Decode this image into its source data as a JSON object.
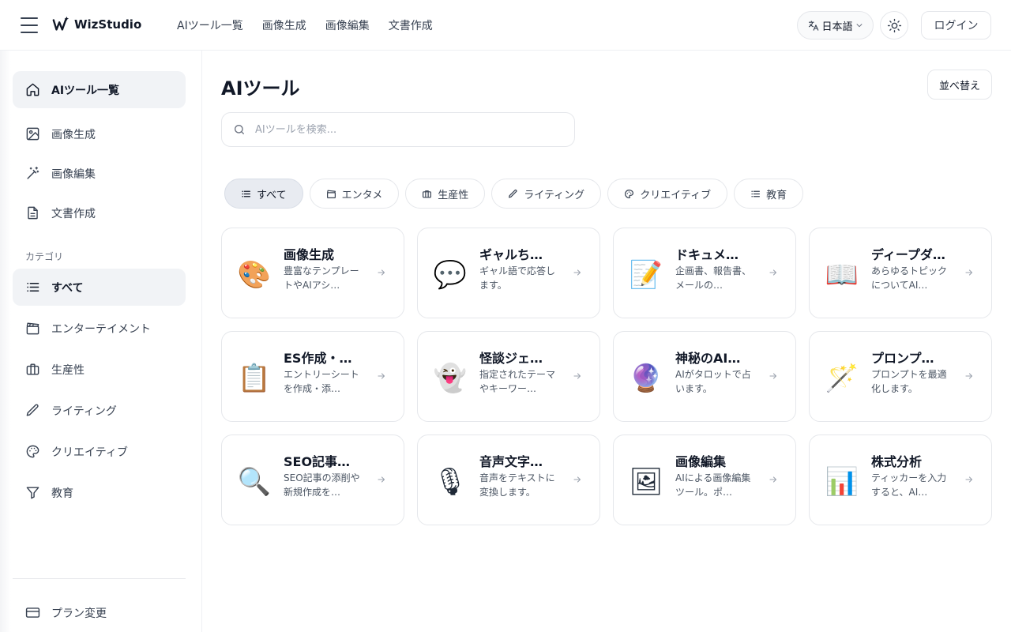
{
  "header": {
    "logo_text": "WizStudio",
    "nav": [
      "AIツール一覧",
      "画像生成",
      "画像編集",
      "文書作成"
    ],
    "lang_label": "日本語",
    "login_label": "ログイン"
  },
  "sidebar": {
    "main_items": [
      {
        "label": "AIツール一覧",
        "icon": "home-icon",
        "active": true
      },
      {
        "label": "画像生成",
        "icon": "image-icon"
      },
      {
        "label": "画像編集",
        "icon": "magic-wand-icon"
      },
      {
        "label": "文書作成",
        "icon": "document-icon"
      }
    ],
    "category_heading": "カテゴリ",
    "category_items": [
      {
        "label": "すべて",
        "icon": "list-icon",
        "active": true
      },
      {
        "label": "エンターテイメント",
        "icon": "clapperboard-icon"
      },
      {
        "label": "生産性",
        "icon": "briefcase-icon"
      },
      {
        "label": "ライティング",
        "icon": "pencil-icon"
      },
      {
        "label": "クリエイティブ",
        "icon": "palette-icon"
      },
      {
        "label": "教育",
        "icon": "filter-icon"
      }
    ],
    "footer_item": {
      "label": "プラン変更",
      "icon": "credit-card-icon"
    }
  },
  "main": {
    "title": "AIツール",
    "sort_label": "並べ替え",
    "search_placeholder": "AIツールを検索...",
    "chips": [
      {
        "label": "すべて",
        "icon": "list-icon",
        "active": true
      },
      {
        "label": "エンタメ",
        "icon": "clapperboard-icon"
      },
      {
        "label": "生産性",
        "icon": "briefcase-icon"
      },
      {
        "label": "ライティング",
        "icon": "pencil-icon"
      },
      {
        "label": "クリエイティブ",
        "icon": "palette-icon"
      },
      {
        "label": "教育",
        "icon": "list-icon"
      }
    ],
    "cards": [
      {
        "title": "画像生成",
        "desc": "豊富なテンプレートやAIアシ…",
        "icon": "🎨"
      },
      {
        "title": "ギャルち…",
        "desc": "ギャル語で応答します。",
        "icon": "💬"
      },
      {
        "title": "ドキュメ…",
        "desc": "企画書、報告書、メールの…",
        "icon": "📝"
      },
      {
        "title": "ディープダ…",
        "desc": "あらゆるトピックについてAI…",
        "icon": "📖"
      },
      {
        "title": "ES作成・…",
        "desc": "エントリーシートを作成・添…",
        "icon": "📋"
      },
      {
        "title": "怪談ジェ…",
        "desc": "指定されたテーマやキーワー…",
        "icon": "👻"
      },
      {
        "title": "神秘のAI…",
        "desc": "AIがタロットで占います。",
        "icon": "🔮"
      },
      {
        "title": "プロンプ…",
        "desc": "プロンプトを最適化します。",
        "icon": "🪄"
      },
      {
        "title": "SEO記事…",
        "desc": "SEO記事の添削や新規作成を…",
        "icon": "🔍"
      },
      {
        "title": "音声文字…",
        "desc": "音声をテキストに変換します。",
        "icon": "🎙"
      },
      {
        "title": "画像編集",
        "desc": "AIによる画像編集ツール。ポ…",
        "icon": "🖼"
      },
      {
        "title": "株式分析",
        "desc": "ティッカーを入力すると、AI…",
        "icon": "📊"
      }
    ]
  }
}
